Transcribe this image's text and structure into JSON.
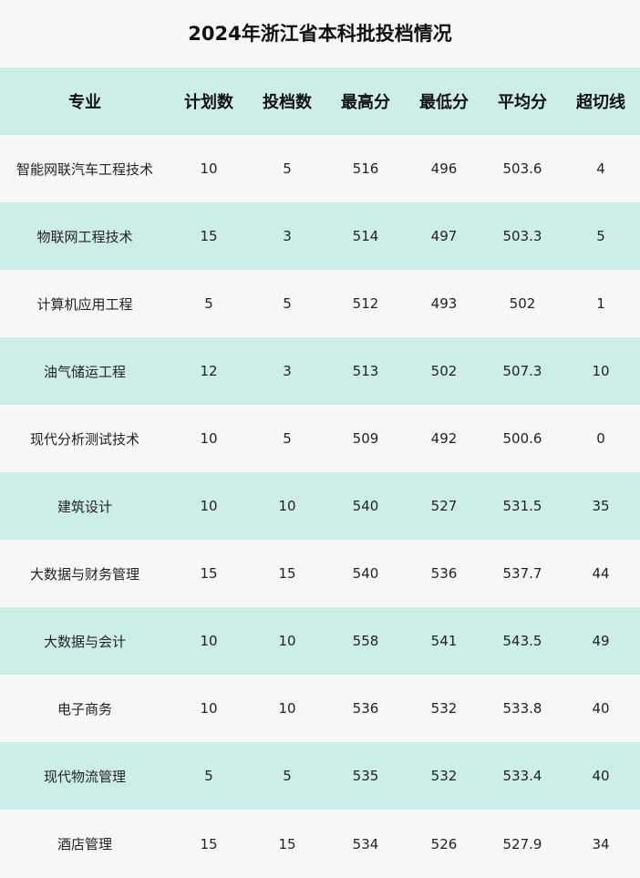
{
  "title": "2024年浙江省本科批投档情况",
  "columns": [
    "专业",
    "计划数",
    "投档数",
    "最高分",
    "最低分",
    "平均分",
    "超切线"
  ],
  "rows": [
    [
      "智能网联汽车工程技术",
      "10",
      "5",
      "516",
      "496",
      "503.6",
      "4"
    ],
    [
      "物联网工程技术",
      "15",
      "3",
      "514",
      "497",
      "503.3",
      "5"
    ],
    [
      "计算机应用工程",
      "5",
      "5",
      "512",
      "493",
      "502",
      "1"
    ],
    [
      "油气储运工程",
      "12",
      "3",
      "513",
      "502",
      "507.3",
      "10"
    ],
    [
      "现代分析测试技术",
      "10",
      "5",
      "509",
      "492",
      "500.6",
      "0"
    ],
    [
      "建筑设计",
      "10",
      "10",
      "540",
      "527",
      "531.5",
      "35"
    ],
    [
      "大数据与财务管理",
      "15",
      "15",
      "540",
      "536",
      "537.7",
      "44"
    ],
    [
      "大数据与会计",
      "10",
      "10",
      "558",
      "541",
      "543.5",
      "49"
    ],
    [
      "电子商务",
      "10",
      "10",
      "536",
      "532",
      "533.8",
      "40"
    ],
    [
      "现代物流管理",
      "5",
      "5",
      "535",
      "532",
      "533.4",
      "40"
    ],
    [
      "酒店管理",
      "15",
      "15",
      "534",
      "526",
      "527.9",
      "34"
    ]
  ],
  "colors": {
    "band": "#cdeee8",
    "background": "#f7f7f7"
  }
}
